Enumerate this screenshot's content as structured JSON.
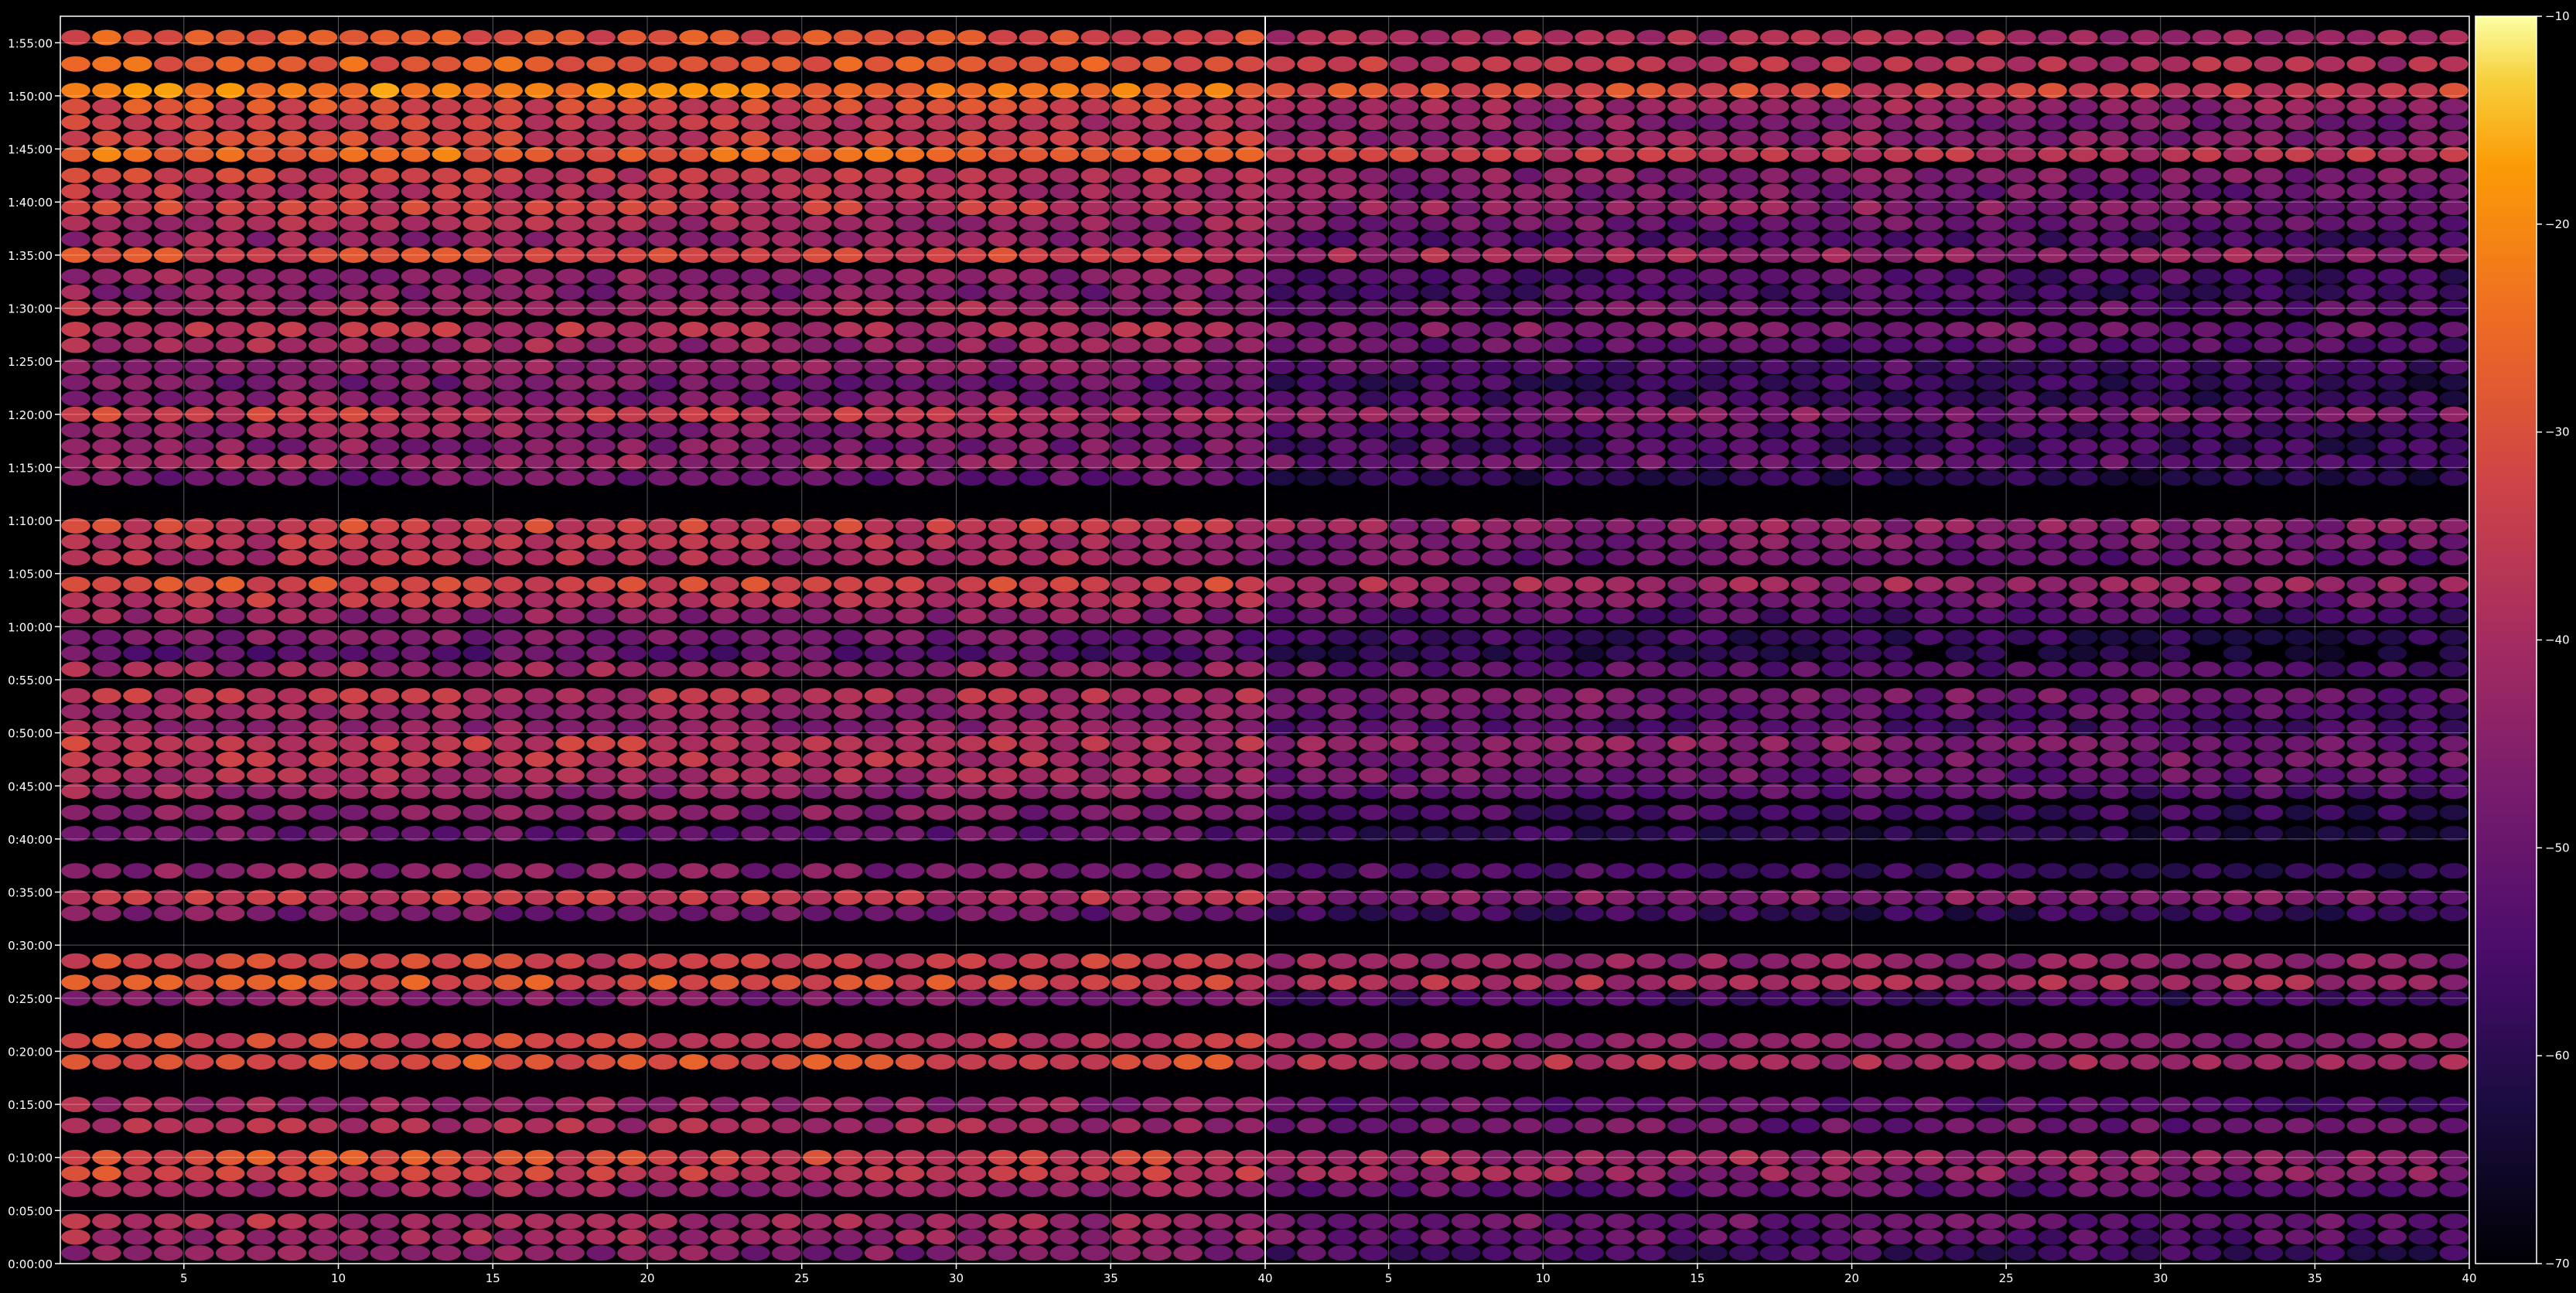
{
  "chart_data": {
    "type": "heatmap",
    "title": "",
    "xlabel": "",
    "ylabel": "",
    "grid": true,
    "colormap": "inferno",
    "colorbar": {
      "vmin": -70,
      "vmax": -10,
      "ticks": [
        {
          "value": -10,
          "label": "−10"
        },
        {
          "value": -20,
          "label": "−20"
        },
        {
          "value": -30,
          "label": "−30"
        },
        {
          "value": -40,
          "label": "−40"
        },
        {
          "value": -50,
          "label": "−50"
        },
        {
          "value": -60,
          "label": "−60"
        },
        {
          "value": -70,
          "label": "−70"
        }
      ]
    },
    "y": {
      "range_minutes": [
        0,
        117.5
      ],
      "ticks": [
        {
          "value": 0,
          "label": "0:00:00"
        },
        {
          "value": 5,
          "label": "0:05:00"
        },
        {
          "value": 10,
          "label": "0:10:00"
        },
        {
          "value": 15,
          "label": "0:15:00"
        },
        {
          "value": 20,
          "label": "0:20:00"
        },
        {
          "value": 25,
          "label": "0:25:00"
        },
        {
          "value": 30,
          "label": "0:30:00"
        },
        {
          "value": 35,
          "label": "0:35:00"
        },
        {
          "value": 40,
          "label": "0:40:00"
        },
        {
          "value": 45,
          "label": "0:45:00"
        },
        {
          "value": 50,
          "label": "0:50:00"
        },
        {
          "value": 55,
          "label": "0:55:00"
        },
        {
          "value": 60,
          "label": "1:00:00"
        },
        {
          "value": 65,
          "label": "1:05:00"
        },
        {
          "value": 70,
          "label": "1:10:00"
        },
        {
          "value": 75,
          "label": "1:15:00"
        },
        {
          "value": 80,
          "label": "1:20:00"
        },
        {
          "value": 85,
          "label": "1:25:00"
        },
        {
          "value": 90,
          "label": "1:30:00"
        },
        {
          "value": 95,
          "label": "1:35:00"
        },
        {
          "value": 100,
          "label": "1:40:00"
        },
        {
          "value": 105,
          "label": "1:45:00"
        },
        {
          "value": 110,
          "label": "1:50:00"
        },
        {
          "value": 115,
          "label": "1:55:00"
        }
      ]
    },
    "panels": [
      {
        "name": "",
        "x_range": [
          1,
          40
        ],
        "channels": [
          1,
          39
        ],
        "x_ticks": [
          {
            "value": 5,
            "label": "5"
          },
          {
            "value": 10,
            "label": "10"
          },
          {
            "value": 15,
            "label": "15"
          },
          {
            "value": 20,
            "label": "20"
          },
          {
            "value": 25,
            "label": "25"
          },
          {
            "value": 30,
            "label": "30"
          },
          {
            "value": 35,
            "label": "35"
          },
          {
            "value": 40,
            "label": "40"
          }
        ],
        "offset_db": 0
      },
      {
        "name": "",
        "x_range": [
          1,
          40
        ],
        "channels": [
          1,
          39
        ],
        "x_ticks": [
          {
            "value": 5,
            "label": "5"
          },
          {
            "value": 10,
            "label": "10"
          },
          {
            "value": 15,
            "label": "15"
          },
          {
            "value": 20,
            "label": "20"
          },
          {
            "value": 25,
            "label": "25"
          },
          {
            "value": 30,
            "label": "30"
          },
          {
            "value": 35,
            "label": "35"
          },
          {
            "value": 40,
            "label": "40"
          }
        ],
        "offset_db": -10
      }
    ],
    "bright_rows": [
      {
        "time_min": 115.5,
        "level": -28
      },
      {
        "time_min": 113,
        "level": -26
      },
      {
        "time_min": 110.5,
        "level": -20
      },
      {
        "time_min": 109,
        "level": -30
      },
      {
        "time_min": 107.5,
        "level": -34
      },
      {
        "time_min": 106,
        "level": -32
      },
      {
        "time_min": 104.5,
        "level": -24
      },
      {
        "time_min": 102.5,
        "level": -34
      },
      {
        "time_min": 101,
        "level": -36
      },
      {
        "time_min": 99.5,
        "level": -33
      },
      {
        "time_min": 98,
        "level": -38
      },
      {
        "time_min": 96.5,
        "level": -42
      },
      {
        "time_min": 95,
        "level": -30
      },
      {
        "time_min": 93,
        "level": -42
      },
      {
        "time_min": 91.5,
        "level": -44
      },
      {
        "time_min": 90,
        "level": -38
      },
      {
        "time_min": 88,
        "level": -36
      },
      {
        "time_min": 86.5,
        "level": -40
      },
      {
        "time_min": 84.5,
        "level": -42
      },
      {
        "time_min": 83,
        "level": -46
      },
      {
        "time_min": 81.5,
        "level": -44
      },
      {
        "time_min": 80,
        "level": -34
      },
      {
        "time_min": 78.5,
        "level": -42
      },
      {
        "time_min": 77,
        "level": -44
      },
      {
        "time_min": 75.5,
        "level": -40
      },
      {
        "time_min": 74,
        "level": -48
      },
      {
        "time_min": 69.5,
        "level": -32
      },
      {
        "time_min": 68,
        "level": -36
      },
      {
        "time_min": 66.5,
        "level": -38
      },
      {
        "time_min": 64,
        "level": -30
      },
      {
        "time_min": 62.5,
        "level": -36
      },
      {
        "time_min": 61,
        "level": -42
      },
      {
        "time_min": 59,
        "level": -46
      },
      {
        "time_min": 57.5,
        "level": -50
      },
      {
        "time_min": 56,
        "level": -40
      },
      {
        "time_min": 53.5,
        "level": -36
      },
      {
        "time_min": 52,
        "level": -40
      },
      {
        "time_min": 50.5,
        "level": -42
      },
      {
        "time_min": 49,
        "level": -34
      },
      {
        "time_min": 47.5,
        "level": -36
      },
      {
        "time_min": 46,
        "level": -38
      },
      {
        "time_min": 44.5,
        "level": -42
      },
      {
        "time_min": 42.5,
        "level": -44
      },
      {
        "time_min": 40.5,
        "level": -48
      },
      {
        "time_min": 37,
        "level": -44
      },
      {
        "time_min": 34.5,
        "level": -34
      },
      {
        "time_min": 33,
        "level": -46
      },
      {
        "time_min": 28.5,
        "level": -32
      },
      {
        "time_min": 26.5,
        "level": -28
      },
      {
        "time_min": 25,
        "level": -44
      },
      {
        "time_min": 21,
        "level": -32
      },
      {
        "time_min": 19,
        "level": -28
      },
      {
        "time_min": 15,
        "level": -40
      },
      {
        "time_min": 13,
        "level": -38
      },
      {
        "time_min": 10,
        "level": -30
      },
      {
        "time_min": 8.5,
        "level": -32
      },
      {
        "time_min": 7,
        "level": -40
      },
      {
        "time_min": 4,
        "level": -38
      },
      {
        "time_min": 2.5,
        "level": -40
      },
      {
        "time_min": 1,
        "level": -44
      }
    ]
  }
}
